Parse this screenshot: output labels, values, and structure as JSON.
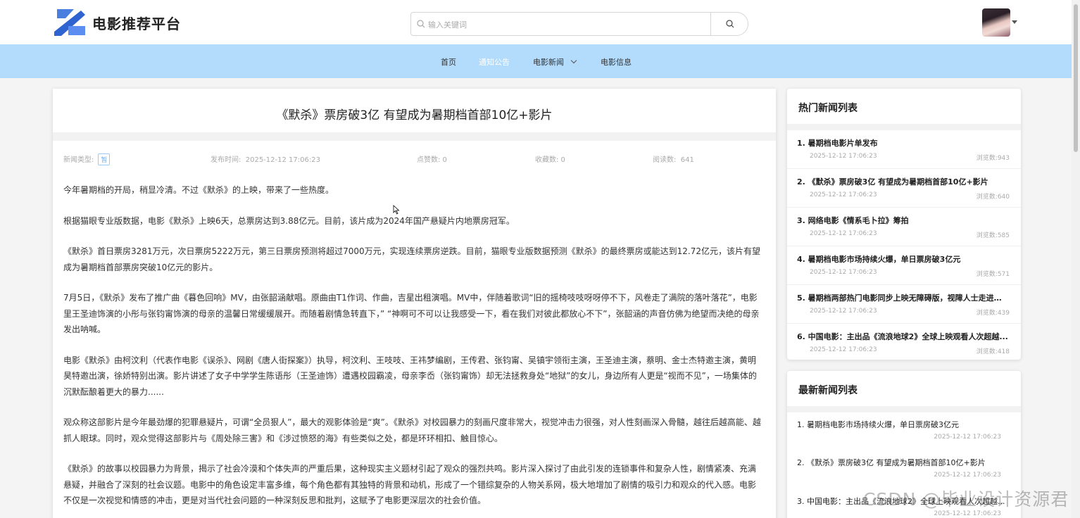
{
  "header": {
    "brand": "电影推荐平台",
    "search_placeholder": "输入关键词"
  },
  "nav": {
    "items": [
      {
        "label": "首页"
      },
      {
        "label": "通知公告"
      },
      {
        "label": "电影新闻"
      },
      {
        "label": "电影信息"
      }
    ]
  },
  "article": {
    "title": "《默杀》票房破3亿 有望成为暑期档首部10亿+影片",
    "type_label": "新闻类型:",
    "type_tag": "暂",
    "publish_label": "发布时间:",
    "publish_time": "2025-12-12 17:06:23",
    "likes": "点赞数: 0",
    "favorites": "收藏数: 0",
    "reads_label": "阅读数:",
    "reads": "641",
    "paragraphs": [
      "今年暑期档的开局，稍显冷清。不过《默杀》的上映，带来了一些热度。",
      "根据猫眼专业版数据，电影《默杀》上映6天，总票房达到3.88亿元。目前，该片成为2024年国产悬疑片内地票房冠军。",
      "《默杀》首日票房3281万元，次日票房5222万元，第三日票房预测将超过7000万元，实现连续票房逆跌。目前，猫眼专业版数据预测《默杀》的最终票房或能达到12.72亿元，该片有望成为暑期档首部票房突破10亿元的影片。",
      "7月5日，《默杀》发布了推广曲《暮色回响》MV，由张韶涵献唱。原曲由T1作词、作曲，吉星出租演唱。MV中，伴随着歌词“旧的摇椅吱吱呀呀停不下，风卷走了满院的落叶落花”，电影里王圣迪饰演的小彤与张钧甯饰演的母亲的温馨日常缓缓展开。而随着剧情急转直下，”  “神啊可不可以让我感受一下，看在我们对彼此都放心不下”，张韶涵的声音仿佛为绝望而决绝的母亲发出呐喊。",
      "电影《默杀》由柯汶利（代表作电影《误杀》、网剧《唐人街探案》）执导，柯汶利、王吱吱、王祎梦编剧，王传君、张钧甯、吴镇宇领衔主演，王圣迪主演，蔡明、金士杰特邀主演，黄明昊特邀出演，徐娇特别出演。影片讲述了女子中学学生陈语彤（王圣迪饰）遭遇校园霸凌，母亲李岙（张钧甯饰）却无法拯救身处“地狱”的女儿，身边所有人更是“视而不见”，一场集体的沉默酝酿着更大的暴力......",
      "观众称这部影片是今年最劲爆的犯罪悬疑片，可谓“全员狠人”，最大的观影体验是“爽”。《默杀》对校园暴力的刻画尺度非常大，视觉冲击力很强，对人性刻画深入骨髓，越往后越高能、越抓人眼球。同时，观众觉得这部影片与《周处除三害》和《涉过愤怒的海》有些类似之处，都是环环相扣、触目惊心。",
      "《默杀》的故事以校园暴力为背景，揭示了社会冷漠和个体失声的严重后果，这种现实主义题材引起了观众的强烈共鸣。影片深入探讨了由此引发的连锁事件和复杂人性，剧情紧凑、充满悬疑，并融合了深刻的社会议题。电影中的角色设定丰富多维，每个角色都有其独特的背景和动机，形成了一个错综复杂的人物关系网，极大地增加了剧情的吸引力和观众的代入感。电影不仅是一次视觉和情感的冲击，更是对当代社会问题的一种深刻反思和批判，这赋予了电影更深层次的社会价值。"
    ]
  },
  "hot_news": {
    "title": "热门新闻列表",
    "items": [
      {
        "title": "1.   暑期档电影片单发布",
        "date": "2025-12-12 17:06:23",
        "views": "浏览数:943"
      },
      {
        "title": "2.   《默杀》票房破3亿 有望成为暑期档首部10亿+影片",
        "date": "2025-12-12 17:06:23",
        "views": "浏览数:640"
      },
      {
        "title": "3.   网络电影《情系毛卜拉》筹拍",
        "date": "2025-12-12 17:06:23",
        "views": "浏览数:585"
      },
      {
        "title": "4.   暑期档电影市场持续火爆，单日票房破3亿元",
        "date": "2025-12-12 17:06:23",
        "views": "浏览数:571"
      },
      {
        "title": "5.   暑期档两部热门电影同步上映无障碍版，视障人士走进影院",
        "date": "2025-12-12 17:06:23",
        "views": "浏览数:439"
      },
      {
        "title": "6.   中国电影：主出品《流浪地球2》全球上映观看人次超越...",
        "date": "2025-12-12 17:06:23",
        "views": "浏览数:418"
      }
    ]
  },
  "latest_news": {
    "title": "最新新闻列表",
    "items": [
      {
        "title": "1.  暑期档电影市场持续火爆，单日票房破3亿元",
        "date": "2025-12-12 17:06:23"
      },
      {
        "title": "2.  《默杀》票房破3亿 有望成为暑期档首部10亿+影片",
        "date": "2025-12-12 17:06:23"
      },
      {
        "title": "3.  中国电影：主出品《流浪地球2》全球上映观看人次超越...",
        "date": "2025-12-12 17:06:23"
      }
    ]
  },
  "watermark": "CSDN @毕业设计资源君",
  "colors": {
    "nav_bg": "#b3dbfb",
    "brand_blue": "#3b7ddd",
    "tag_border": "#9cc9f5"
  }
}
